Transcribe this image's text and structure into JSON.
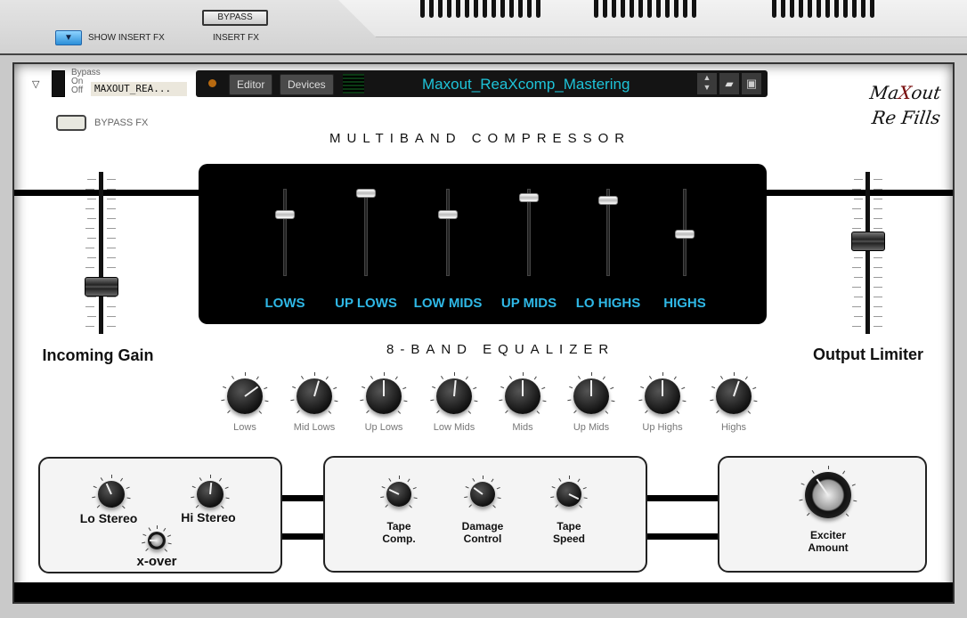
{
  "topbar": {
    "show_insert_fx": "SHOW INSERT FX",
    "bypass_button": "BYPASS",
    "insert_fx": "INSERT FX"
  },
  "device": {
    "bypass": "Bypass",
    "on": "On",
    "off": "Off",
    "name_tape": "MAXOUT_REA...",
    "bypass_fx": "BYPASS FX",
    "editor": "Editor",
    "devices": "Devices",
    "patch_name": "Maxout_ReaXcomp_Mastering",
    "logo": "MaXout ReFills"
  },
  "colors": {
    "accent": "#2fb8e6",
    "patch_text": "#1ec3d8"
  },
  "compressor": {
    "title": "MULTIBAND   COMPRESSOR",
    "faders": [
      {
        "label": "LOWS",
        "value": 0.7
      },
      {
        "label": "UP LOWS",
        "value": 0.95
      },
      {
        "label": "LOW MIDS",
        "value": 0.7
      },
      {
        "label": "UP MIDS",
        "value": 0.9
      },
      {
        "label": "LO HIGHS",
        "value": 0.87
      },
      {
        "label": "HIGHS",
        "value": 0.48
      }
    ]
  },
  "incoming_gain": {
    "label": "Incoming Gain",
    "value": 0.29
  },
  "output_limiter": {
    "label": "Output Limiter",
    "value": 0.57
  },
  "eq": {
    "title": "8-BAND EQUALIZER",
    "knobs": [
      {
        "label": "Lows",
        "value": 0.7
      },
      {
        "label": "Mid Lows",
        "value": 0.56
      },
      {
        "label": "Up Lows",
        "value": 0.5
      },
      {
        "label": "Low Mids",
        "value": 0.52
      },
      {
        "label": "Mids",
        "value": 0.5
      },
      {
        "label": "Up Mids",
        "value": 0.5
      },
      {
        "label": "Up Highs",
        "value": 0.5
      },
      {
        "label": "Highs",
        "value": 0.57
      }
    ]
  },
  "stereo": {
    "lo_stereo": {
      "label": "Lo Stereo",
      "value": 0.41
    },
    "hi_stereo": {
      "label": "Hi Stereo",
      "value": 0.52
    },
    "xover": {
      "label": "x-over",
      "value": 0.17
    }
  },
  "tape": {
    "comp": {
      "label1": "Tape",
      "label2": "Comp.",
      "value": 0.26
    },
    "damage": {
      "label1": "Damage",
      "label2": "Control",
      "value": 0.3
    },
    "speed": {
      "label1": "Tape",
      "label2": "Speed",
      "value": 0.93
    }
  },
  "exciter": {
    "label1": "Exciter",
    "label2": "Amount",
    "value": 0.37
  }
}
